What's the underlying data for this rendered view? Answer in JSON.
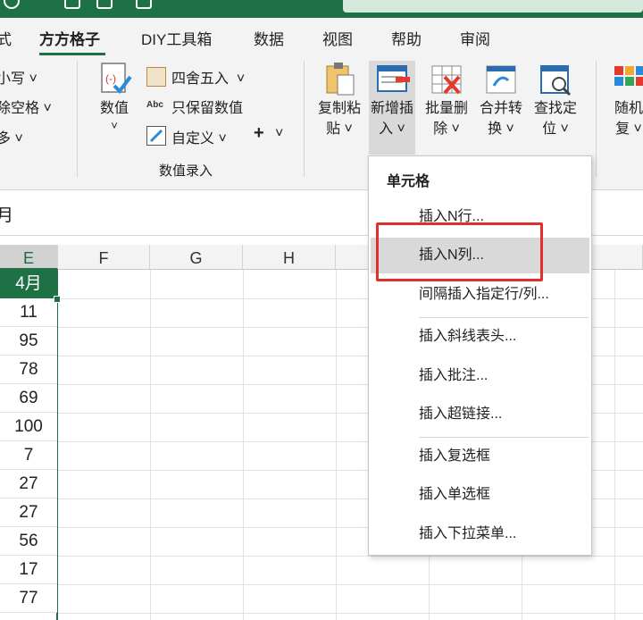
{
  "tabs": [
    "式",
    "方方格子",
    "DIY工具箱",
    "数据",
    "视图",
    "帮助",
    "审阅"
  ],
  "ribbon": {
    "left_items": [
      "小写",
      "除空格",
      "多"
    ],
    "numeric_group": {
      "big_button": "数值",
      "small_items": [
        "四舍五入",
        "只保留数值",
        "自定义"
      ],
      "plus": "+",
      "group_label": "数值录入"
    },
    "buttons": [
      {
        "line1": "复制粘",
        "line2": "贴"
      },
      {
        "line1": "新增插",
        "line2": "入"
      },
      {
        "line1": "批量删",
        "line2": "除"
      },
      {
        "line1": "合并转",
        "line2": "换"
      },
      {
        "line1": "查找定",
        "line2": "位"
      },
      {
        "line1": "随机",
        "line2": "复"
      }
    ]
  },
  "formula_bar": {
    "value": "月"
  },
  "sheet": {
    "columns": [
      "E",
      "F",
      "G",
      "H"
    ],
    "cells": [
      "4月",
      "11",
      "95",
      "78",
      "69",
      "100",
      "7",
      "27",
      "27",
      "56",
      "17",
      "77"
    ]
  },
  "dropdown": {
    "header": "单元格",
    "items": [
      "插入N行...",
      "插入N列...",
      "间隔插入指定行/列...",
      "插入斜线表头...",
      "插入批注...",
      "插入超链接...",
      "插入复选框",
      "插入单选框",
      "插入下拉菜单..."
    ],
    "highlighted": "插入N列..."
  },
  "colors": {
    "accent": "#1e7145",
    "highlight_box": "#e0302a"
  }
}
